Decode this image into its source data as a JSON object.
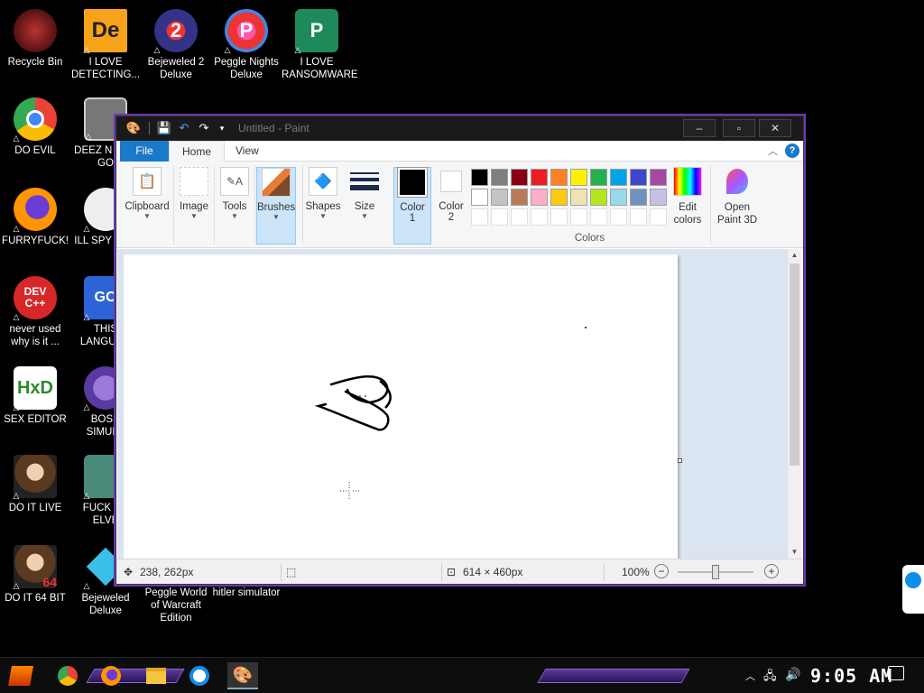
{
  "desktop_icons": [
    {
      "label": "Recycle Bin"
    },
    {
      "label": "I LOVE DETECTING..."
    },
    {
      "label": "Bejeweled 2 Deluxe"
    },
    {
      "label": "Peggle Nights Deluxe"
    },
    {
      "label": "I LOVE RANSOMWARE"
    },
    {
      "label": "DO EVIL"
    },
    {
      "label": "DEEZ N HAH GO"
    },
    {
      "label": "FURRYFUCK!"
    },
    {
      "label": "ILL SPY YOU"
    },
    {
      "label": "never used why is it ..."
    },
    {
      "label": "THIS LANGUAG"
    },
    {
      "label": "SEX EDITOR"
    },
    {
      "label": "BOSN SIMULA"
    },
    {
      "label": "DO IT LIVE"
    },
    {
      "label": "FUCK SC ELVE"
    },
    {
      "label": "DO IT 64 BIT"
    },
    {
      "label": "Bejeweled Deluxe"
    },
    {
      "label": "Peggle World of Warcraft Edition"
    },
    {
      "label": "hitler simulator"
    }
  ],
  "paint": {
    "title": "Untitled - Paint",
    "tabs": {
      "file": "File",
      "home": "Home",
      "view": "View"
    },
    "ribbon": {
      "clipboard": "Clipboard",
      "image": "Image",
      "tools": "Tools",
      "brushes": "Brushes",
      "shapes": "Shapes",
      "size": "Size",
      "color1": "Color",
      "color1_num": "1",
      "color2": "Color",
      "color2_num": "2",
      "colors_group": "Colors",
      "edit_colors": "Edit colors",
      "open_paint3d": "Open Paint 3D"
    },
    "palette_row1": [
      "#000000",
      "#7f7f7f",
      "#880015",
      "#ed1c24",
      "#ff7f27",
      "#fff200",
      "#22b14c",
      "#00a2e8",
      "#3f48cc",
      "#a349a4"
    ],
    "palette_row2": [
      "#ffffff",
      "#c3c3c3",
      "#b97a57",
      "#ffaec9",
      "#ffc90e",
      "#efe4b0",
      "#b5e61d",
      "#99d9ea",
      "#7092be",
      "#c8bfe7"
    ],
    "status": {
      "cursor_pos": "238, 262px",
      "canvas_size": "614 × 460px",
      "zoom": "100%"
    }
  },
  "taskbar": {
    "clock": "9:05 AM"
  }
}
